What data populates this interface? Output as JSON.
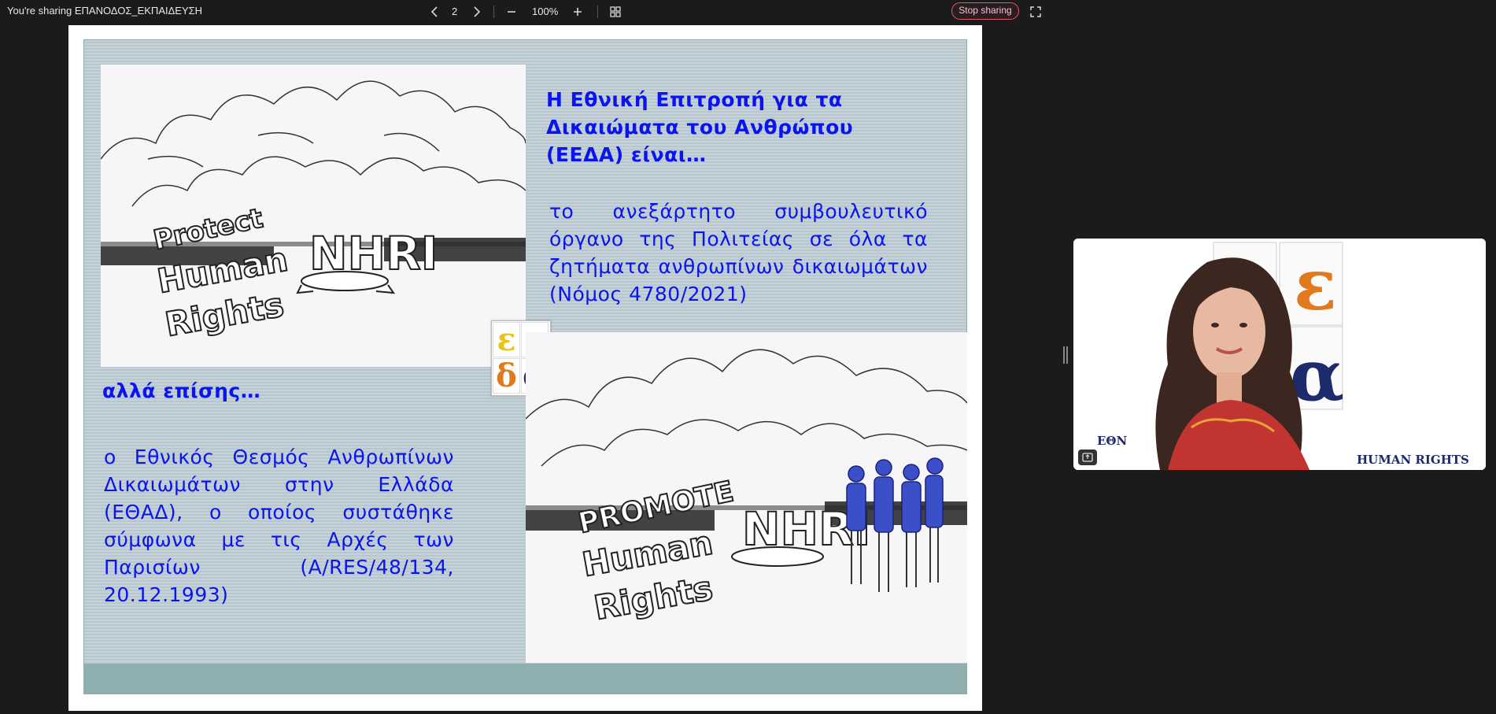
{
  "topbar": {
    "share_title": "You're sharing ΕΠΑΝΟΔΟΣ_ΕΚΠΑΙΔΕΥΣΗ",
    "page_number": "2",
    "zoom_level": "100%",
    "stop_sharing_label": "Stop sharing",
    "icons": [
      "chevron-left-icon",
      "chevron-right-icon",
      "zoom-out-icon",
      "zoom-in-icon",
      "grid-view-icon",
      "fullscreen-icon"
    ]
  },
  "slide": {
    "heading_top": "Η Εθνική Επιτροπή για τα Δικαιώματα του Ανθρώπου (ΕΕΔΑ)  είναι…",
    "body_top": "το ανεξάρτητο συμβουλευτικό όργανο της Πολιτείας σε όλα τα ζητήματα ανθρωπίνων δικαιωμάτων (Νόμος 4780/2021)",
    "heading_bottom": "αλλά επίσης…",
    "body_bottom": "ο Εθνικός Θεσμός Ανθρωπίνων Δικαιωμάτων στην Ελλάδα (ΕΘΑΔ), ο οποίος συστάθηκε σύμφωνα με τις Αρχές των Παρισίων (A/RES/48/134, 20.12.1993)",
    "image_top": {
      "word1": "Protect",
      "word2": "Human",
      "word3": "Rights",
      "sign": "NHRI"
    },
    "image_bottom": {
      "word1": "PROMOTE",
      "word2": "Human",
      "word3": "Rights",
      "sign": "NHRI"
    },
    "logo_letters": [
      "ε",
      "ε",
      "δ",
      "α"
    ],
    "colors": {
      "text": "#0a14f0",
      "footer": "#8eaeb0",
      "logo_yellow": "#e6c419",
      "logo_orange": "#e07a1d",
      "logo_purple": "#5a2a8a",
      "logo_navy": "#1d2a6b"
    }
  },
  "webcam": {
    "background_text_line1": "ΕΘΝ         Α ΤΟΥ ΑΝΘΡΩΠΟΥ",
    "background_text_line2": "HUMAN RIGHTS",
    "logo_letters": [
      "ε",
      "α"
    ]
  }
}
